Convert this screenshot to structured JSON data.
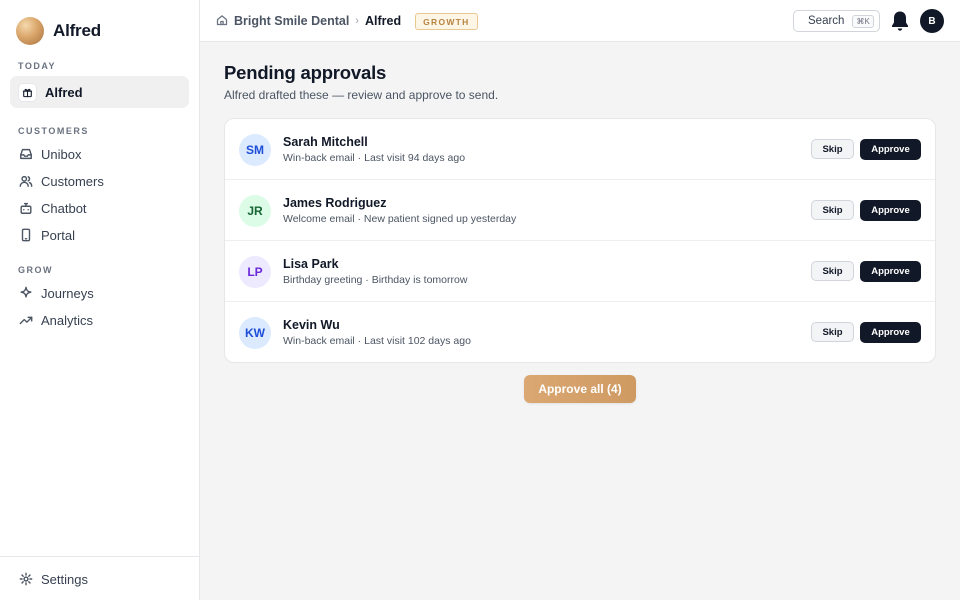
{
  "brand": {
    "name": "Alfred"
  },
  "sidebar": {
    "sections": [
      {
        "label": "TODAY",
        "items": [
          {
            "label": "Alfred",
            "icon": "gift-icon",
            "active": true
          }
        ]
      },
      {
        "label": "CUSTOMERS",
        "items": [
          {
            "label": "Unibox",
            "icon": "inbox-icon"
          },
          {
            "label": "Customers",
            "icon": "users-icon"
          },
          {
            "label": "Chatbot",
            "icon": "bot-icon"
          },
          {
            "label": "Portal",
            "icon": "phone-icon"
          }
        ]
      },
      {
        "label": "GROW",
        "items": [
          {
            "label": "Journeys",
            "icon": "sparkle-icon"
          },
          {
            "label": "Analytics",
            "icon": "trend-icon"
          }
        ]
      }
    ],
    "footer": {
      "label": "Settings",
      "icon": "gear-icon"
    },
    "accent_color": "#d9a065"
  },
  "topbar": {
    "breadcrumb": {
      "org": "Bright Smile Dental",
      "separator": "›",
      "current": "Alfred"
    },
    "plan_badge": "GROWTH",
    "search_label": "Search",
    "search_shortcut": "⌘K",
    "user_initial": "B"
  },
  "main": {
    "title": "Pending approvals",
    "subtitle": "Alfred drafted these — review and approve to send.",
    "approvals": [
      {
        "initials": "SM",
        "name": "Sarah Mitchell",
        "meta": "Win-back email · Last visit 94 days ago",
        "avatar_bg": "#dbeafe",
        "avatar_fg": "#1d4ed8",
        "skip_label": "Skip",
        "approve_label": "Approve"
      },
      {
        "initials": "JR",
        "name": "James Rodriguez",
        "meta": "Welcome email · New patient signed up yesterday",
        "avatar_bg": "#dcfce7",
        "avatar_fg": "#166534",
        "skip_label": "Skip",
        "approve_label": "Approve"
      },
      {
        "initials": "LP",
        "name": "Lisa Park",
        "meta": "Birthday greeting · Birthday is tomorrow",
        "avatar_bg": "#ede9fe",
        "avatar_fg": "#6d28d9",
        "skip_label": "Skip",
        "approve_label": "Approve"
      },
      {
        "initials": "KW",
        "name": "Kevin Wu",
        "meta": "Win-back email · Last visit 102 days ago",
        "avatar_bg": "#dbeafe",
        "avatar_fg": "#1d4ed8",
        "skip_label": "Skip",
        "approve_label": "Approve"
      }
    ],
    "approve_all_label": "Approve all (4)"
  }
}
